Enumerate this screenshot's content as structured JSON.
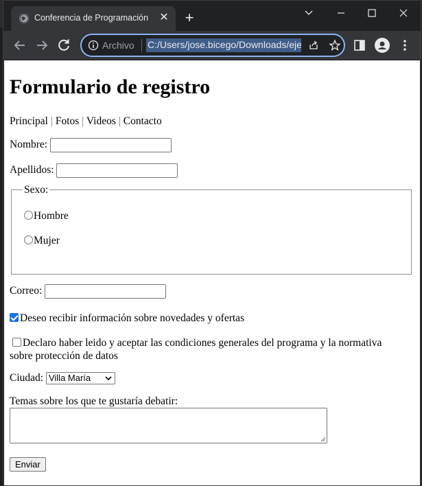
{
  "browser": {
    "tab_title": "Conferencia de Programación",
    "omnibox_scheme": "Archivo",
    "url": "C:/Users/jose.bicego/Downloads/ejercicio"
  },
  "page": {
    "heading": "Formulario de registro",
    "nav": [
      "Principal",
      "Fotos",
      "Videos",
      "Contacto"
    ],
    "nav_separator": "|",
    "nombre_label": "Nombre:",
    "nombre_value": "",
    "apellidos_label": "Apellidos:",
    "apellidos_value": "",
    "sexo_legend": "Sexo:",
    "sexo_options": [
      "Hombre",
      "Mujer"
    ],
    "correo_label": "Correo:",
    "correo_value": "",
    "newsletter_label": "Deseo recibir información sobre novedades y ofertas",
    "newsletter_checked": true,
    "terms_label_line1": "Declaro haber leido y aceptar las condiciones generales del programa y la normativa",
    "terms_label_line2": "sobre protección de datos",
    "terms_checked": false,
    "ciudad_label": "Ciudad:",
    "ciudad_selected": "Villa María",
    "temas_label": "Temas sobre los que te gustaría debatir:",
    "temas_value": "",
    "submit_label": "Enviar"
  },
  "colors": {
    "accent": "#1a73e8",
    "omnibox_focus": "#8ab4f8",
    "chrome_dark": "#202124",
    "chrome_toolbar": "#35363a"
  }
}
